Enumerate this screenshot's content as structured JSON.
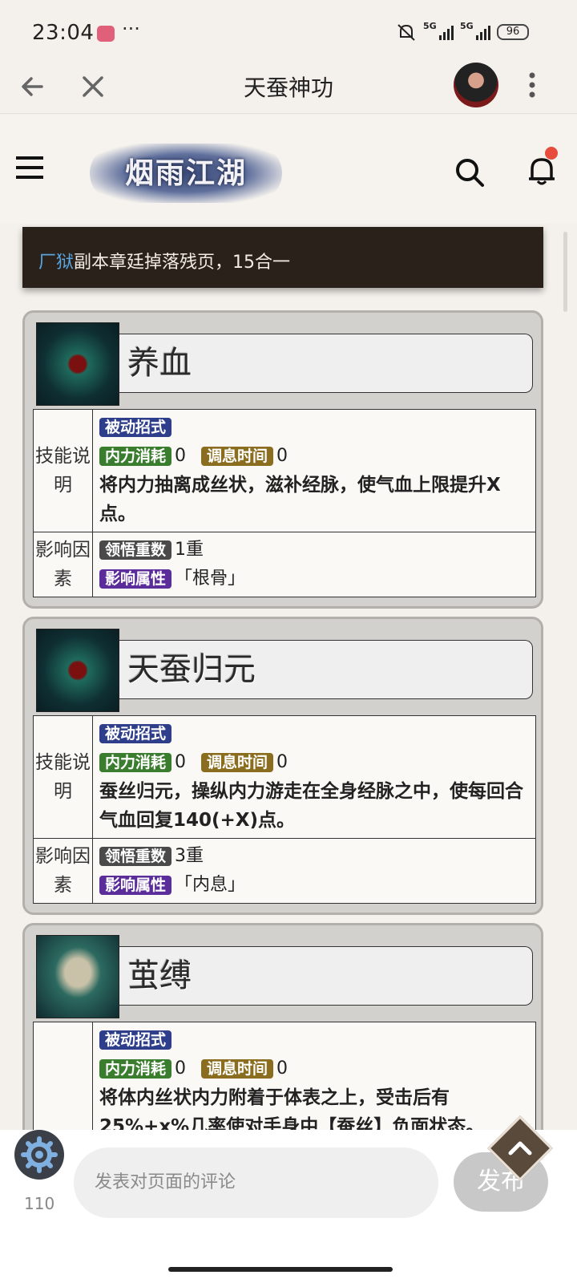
{
  "status_bar": {
    "time": "23:04",
    "app_badge": "小红书",
    "more_dots": "···",
    "network1": "5G",
    "network2": "5G",
    "battery": "96"
  },
  "nav": {
    "title": "天蚕神功"
  },
  "site": {
    "logo_text": "烟雨江湖"
  },
  "notice": {
    "link": "厂狱",
    "text": "副本章廷掉落残页，15合一"
  },
  "labels": {
    "skill_desc": "技能说明",
    "influence": "影响因素",
    "passive_tag": "被动招式",
    "cost_tag": "内力消耗",
    "cooldown_tag": "调息时间",
    "insight_tag": "领悟重数",
    "attr_tag": "影响属性"
  },
  "skills": [
    {
      "name": "养血",
      "cost": "0",
      "cooldown": "0",
      "description": "将内力抽离成丝状，滋补经脉，使气血上限提升X点。",
      "insight": "1重",
      "attribute": "「根骨」"
    },
    {
      "name": "天蚕归元",
      "cost": "0",
      "cooldown": "0",
      "description": "蚕丝归元，操纵内力游走在全身经脉之中，使每回合气血回复140(+X)点。",
      "insight": "3重",
      "attribute": "「内息」"
    },
    {
      "name": "茧缚",
      "cost": "0",
      "cooldown": "0",
      "description": "将体内丝状内力附着于体表之上，受击后有25%+x%几率使对手身中【蚕丝】负面状态。"
    }
  ],
  "bottom": {
    "comment_count": "110",
    "comment_placeholder": "发表对页面的评论",
    "send_label": "发布"
  }
}
